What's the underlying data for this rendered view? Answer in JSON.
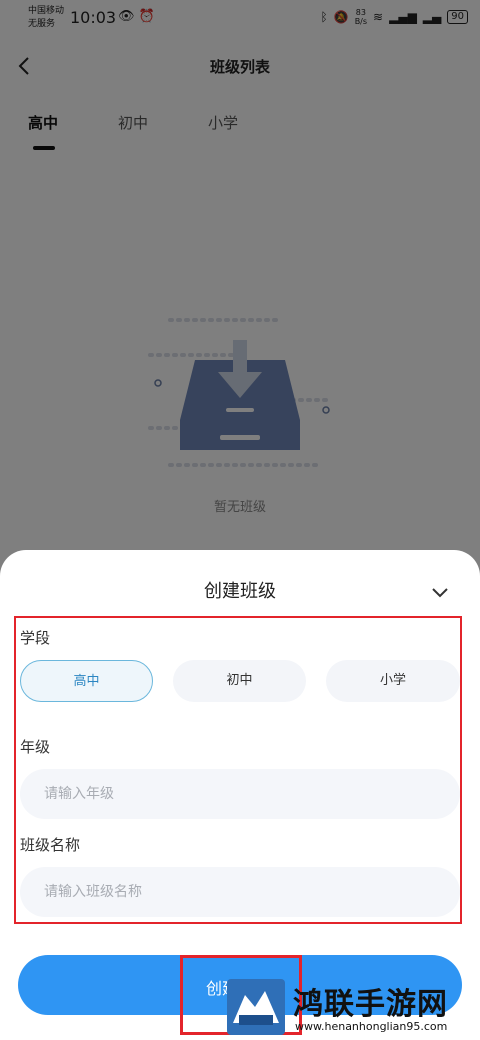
{
  "status_bar": {
    "carrier_line1": "中国移动",
    "carrier_line2": "无服务",
    "time": "10:03",
    "net_speed_value": "83",
    "net_speed_unit": "B/s",
    "battery": "90"
  },
  "header": {
    "title": "班级列表",
    "back_icon": "chevron-left-icon"
  },
  "tabs": [
    {
      "label": "高中",
      "active": true
    },
    {
      "label": "初中",
      "active": false
    },
    {
      "label": "小学",
      "active": false
    }
  ],
  "empty_state": {
    "text": "暂无班级",
    "icon": "inbox-download-icon"
  },
  "sheet": {
    "title": "创建班级",
    "collapse_icon": "chevron-down-icon",
    "stage": {
      "label": "学段",
      "options": [
        "高中",
        "初中",
        "小学"
      ],
      "selected": "高中"
    },
    "grade": {
      "label": "年级",
      "placeholder": "请输入年级"
    },
    "class_name": {
      "label": "班级名称",
      "placeholder": "请输入班级名称"
    },
    "create_button": "创建"
  },
  "watermark": {
    "title": "鸿联手游网",
    "url": "www.henanhonglian95.com"
  },
  "colors": {
    "accent": "#2f95f3",
    "annotation_red": "#e3242b",
    "selected_outline": "#6bb7dc"
  }
}
